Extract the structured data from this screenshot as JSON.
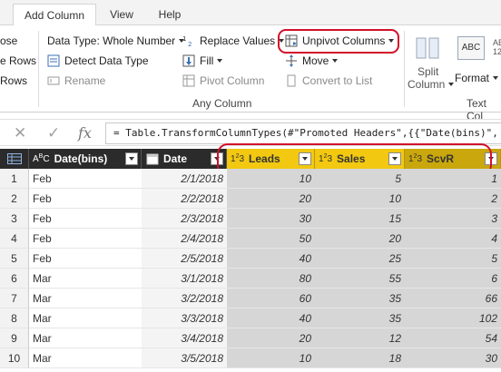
{
  "tabs": [
    {
      "label": "Add Column"
    },
    {
      "label": "View"
    },
    {
      "label": "Help"
    }
  ],
  "ribbon": {
    "left_partial": [
      "ose",
      "e Rows",
      "Rows"
    ],
    "data_type": "Data Type: Whole Number",
    "detect_data_type": "Detect Data Type",
    "rename": "Rename",
    "replace_values": "Replace Values",
    "fill": "Fill",
    "pivot_column": "Pivot Column",
    "unpivot_columns": "Unpivot Columns",
    "move": "Move",
    "convert_to_list": "Convert to List",
    "any_column_group": "Any Column",
    "split_column_line1": "Split",
    "split_column_line2": "Column",
    "format": "Format",
    "text_column_group": "Text Col",
    "abc_glyph": "ABC",
    "digits_glyph": "12"
  },
  "formula_bar": {
    "cancel_glyph": "✕",
    "accept_glyph": "✓",
    "fx_glyph": "fx",
    "formula": "= Table.TransformColumnTypes(#\"Promoted Headers\",{{\"Date(bins)\","
  },
  "table": {
    "columns": [
      {
        "name": "Date(bins)",
        "type": "ABC"
      },
      {
        "name": "Date",
        "type": "date"
      },
      {
        "name": "Leads",
        "type": "123"
      },
      {
        "name": "Sales",
        "type": "123"
      },
      {
        "name": "ScvR",
        "type": "123"
      }
    ],
    "rows": [
      {
        "n": "1",
        "bins": "Feb",
        "date": "2/1/2018",
        "leads": "10",
        "sales": "5",
        "scvr": "1"
      },
      {
        "n": "2",
        "bins": "Feb",
        "date": "2/2/2018",
        "leads": "20",
        "sales": "10",
        "scvr": "2"
      },
      {
        "n": "3",
        "bins": "Feb",
        "date": "2/3/2018",
        "leads": "30",
        "sales": "15",
        "scvr": "3"
      },
      {
        "n": "4",
        "bins": "Feb",
        "date": "2/4/2018",
        "leads": "50",
        "sales": "20",
        "scvr": "4"
      },
      {
        "n": "5",
        "bins": "Feb",
        "date": "2/5/2018",
        "leads": "40",
        "sales": "25",
        "scvr": "5"
      },
      {
        "n": "6",
        "bins": "Mar",
        "date": "3/1/2018",
        "leads": "80",
        "sales": "55",
        "scvr": "6"
      },
      {
        "n": "7",
        "bins": "Mar",
        "date": "3/2/2018",
        "leads": "60",
        "sales": "35",
        "scvr": "66"
      },
      {
        "n": "8",
        "bins": "Mar",
        "date": "3/3/2018",
        "leads": "40",
        "sales": "35",
        "scvr": "102"
      },
      {
        "n": "9",
        "bins": "Mar",
        "date": "3/4/2018",
        "leads": "20",
        "sales": "12",
        "scvr": "54"
      },
      {
        "n": "10",
        "bins": "Mar",
        "date": "3/5/2018",
        "leads": "10",
        "sales": "18",
        "scvr": "30"
      }
    ]
  },
  "colors": {
    "selected_header": "#f2c811",
    "selected_cells": "#d6d6d6",
    "highlight_ring": "#d2102a",
    "header_dark": "#2b2b2b"
  }
}
